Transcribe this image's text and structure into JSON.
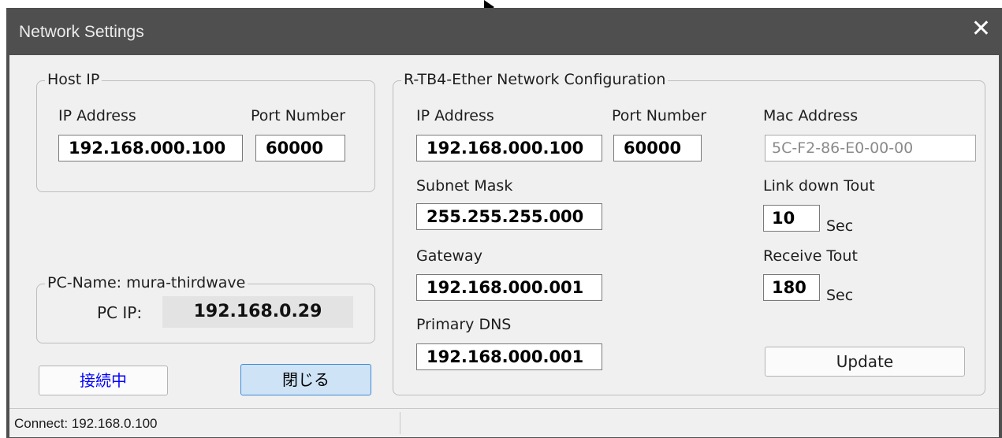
{
  "window": {
    "title": "Network Settings",
    "close_glyph": "✕"
  },
  "host_ip": {
    "group_label": "Host IP",
    "ip_label": "IP Address",
    "port_label": "Port Number",
    "ip_value": "192.168.000.100",
    "port_value": "60000"
  },
  "pc": {
    "group_label": "PC-Name: mura-thirdwave",
    "ip_label": "PC IP:",
    "ip_value": "192.168.0.29"
  },
  "buttons": {
    "connect": "接続中",
    "close": "閉じる",
    "update": "Update"
  },
  "device": {
    "group_label": "R-TB4-Ether Network Configuration",
    "ip_label": "IP Address",
    "ip_value": "192.168.000.100",
    "port_label": "Port Number",
    "port_value": "60000",
    "mac_label": "Mac Address",
    "mac_value": "5C-F2-86-E0-00-00",
    "subnet_label": "Subnet Mask",
    "subnet_value": "255.255.255.000",
    "gateway_label": "Gateway",
    "gateway_value": "192.168.000.001",
    "dns_label": "Primary DNS",
    "dns_value": "192.168.000.001",
    "link_down_label": "Link down Tout",
    "link_down_value": "10",
    "link_down_unit": "Sec",
    "receive_label": "Receive Tout",
    "receive_value": "180",
    "receive_unit": "Sec"
  },
  "status_bar": {
    "text": "Connect: 192.168.0.100"
  },
  "colors": {
    "titlebar": "#4f4f4f",
    "client": "#f0f0f0",
    "connect_text": "#0000ff",
    "close_button": "#cfe3f7"
  }
}
